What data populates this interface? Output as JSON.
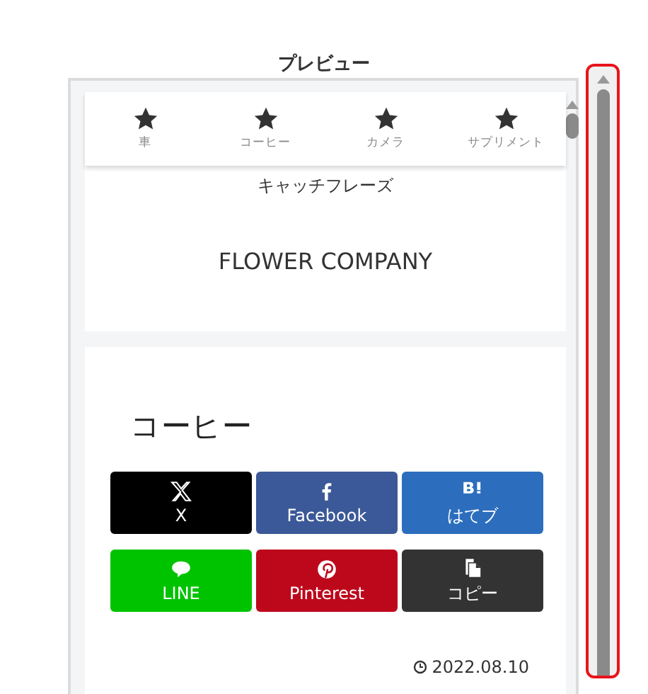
{
  "title": "プレビュー",
  "nav": [
    {
      "label": "車"
    },
    {
      "label": "コーヒー"
    },
    {
      "label": "カメラ"
    },
    {
      "label": "サプリメント"
    }
  ],
  "header": {
    "catchphrase": "キャッチフレーズ",
    "site_name": "FLOWER COMPANY"
  },
  "article": {
    "heading": "コーヒー",
    "share_buttons": [
      {
        "kind": "x",
        "label": "X"
      },
      {
        "kind": "facebook",
        "label": "Facebook"
      },
      {
        "kind": "hatena",
        "label": "はてブ"
      },
      {
        "kind": "line",
        "label": "LINE"
      },
      {
        "kind": "pinterest",
        "label": "Pinterest"
      },
      {
        "kind": "copy",
        "label": "コピー"
      }
    ],
    "date": "2022.08.10"
  }
}
